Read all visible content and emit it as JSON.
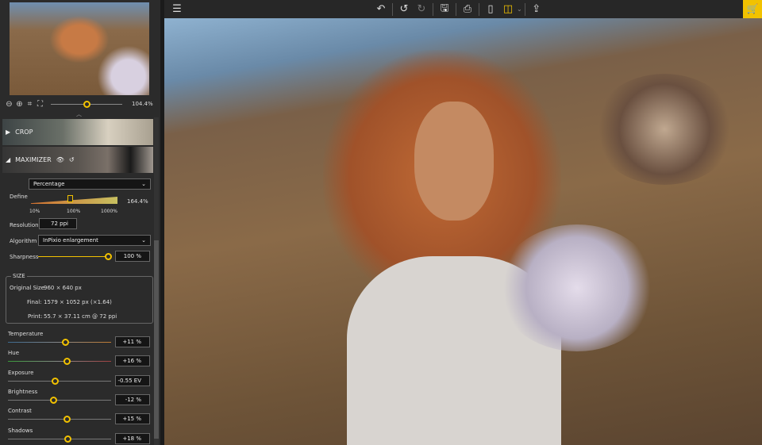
{
  "toolbar": {
    "icons": [
      "menu-icon",
      "revert-icon",
      "undo-icon",
      "redo-icon",
      "save-icon",
      "print-icon",
      "single-view-icon",
      "split-view-icon",
      "chevron-down-icon",
      "share-icon",
      "cart-icon"
    ]
  },
  "navigator": {
    "zoom_pct": "104.4%",
    "zoom_position": 0.5
  },
  "sections": {
    "crop": "CROP",
    "maximizer": "MAXIMIZER"
  },
  "maximizer": {
    "mode": "Percentage",
    "define_label": "Define",
    "define_value": "164.4%",
    "define_position": 0.45,
    "define_ticks": [
      "10%",
      "100%",
      "1000%"
    ],
    "resolution_label": "Resolution",
    "resolution_value": "72 ppi",
    "algorithm_label": "Algorithm",
    "algorithm_value": "InPixio enlargement",
    "sharpness_label": "Sharpness",
    "sharpness_value": "100 %"
  },
  "size": {
    "title": "SIZE",
    "original_label": "Original Size",
    "original": "960 × 640 px",
    "final_label": "Final:",
    "final": "1579 × 1052 px (×1.64)",
    "print_label": "Print:",
    "print": "55.7 × 37.11 cm @ 72 ppi"
  },
  "adjustments": [
    {
      "label": "Temperature",
      "value": "+11 %",
      "position": 0.55
    },
    {
      "label": "Hue",
      "value": "+16 %",
      "position": 0.57
    },
    {
      "label": "Exposure",
      "value": "-0.55 EV",
      "position": 0.45
    },
    {
      "label": "Brightness",
      "value": "-12 %",
      "position": 0.44
    },
    {
      "label": "Contrast",
      "value": "+15 %",
      "position": 0.57
    },
    {
      "label": "Shadows",
      "value": "+18 %",
      "position": 0.58
    }
  ],
  "colors": {
    "accent": "#f2c200"
  }
}
